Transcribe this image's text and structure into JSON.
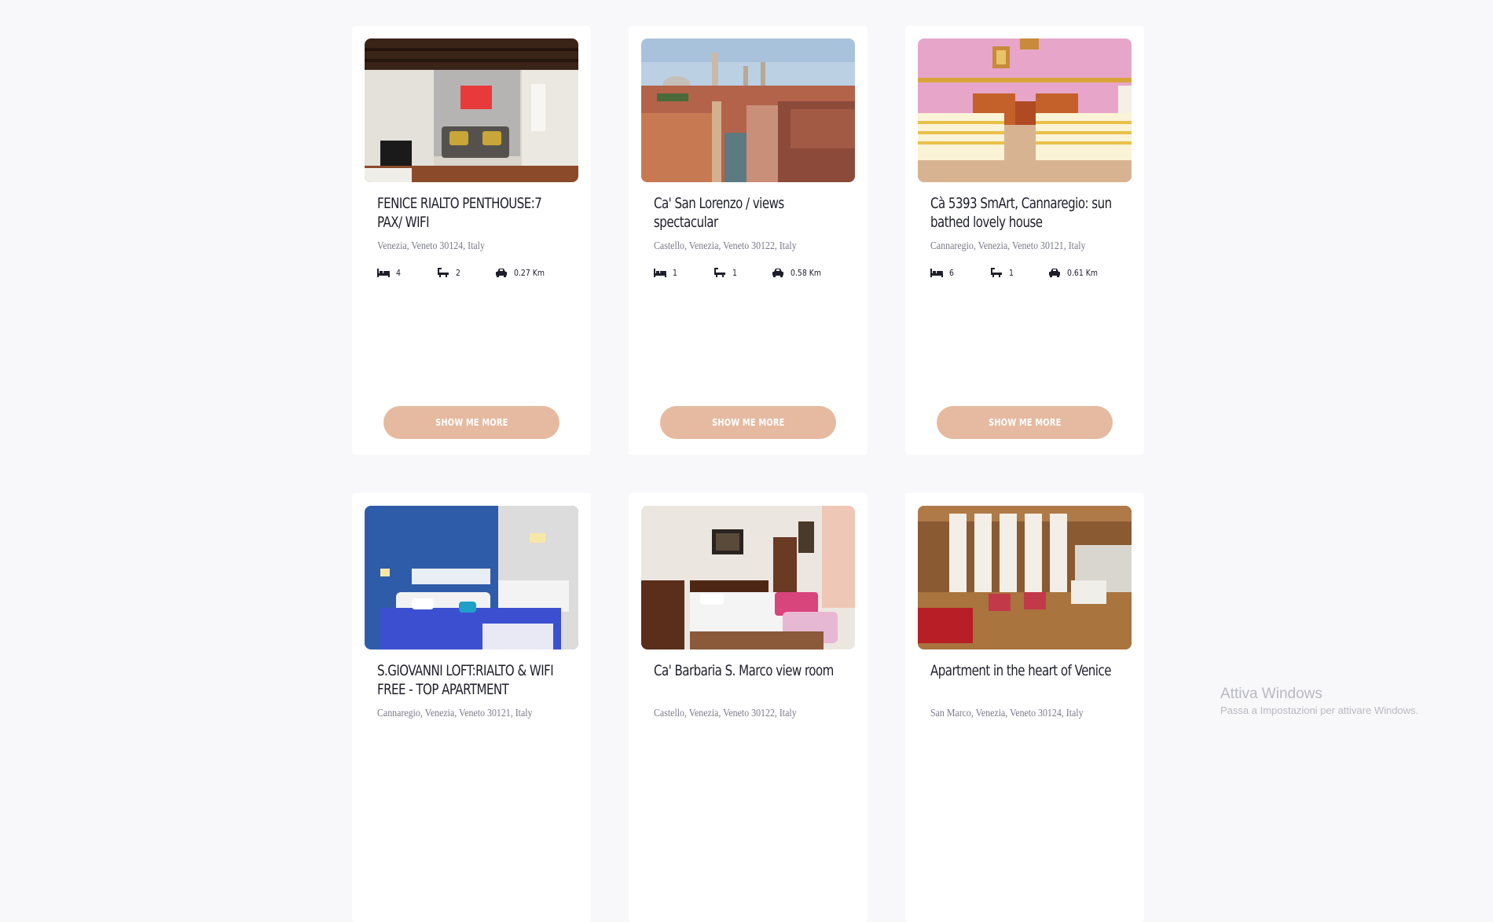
{
  "listings": [
    {
      "title": "FENICE RIALTO PENTHOUSE:7 PAX/ WIFI",
      "address": "Venezia, Veneto 30124, Italy",
      "beds": "4",
      "baths": "2",
      "distance": "0.27 Km",
      "button_label": "SHOW ME MORE",
      "photo": "living-room-sofa-photo"
    },
    {
      "title": "Ca' San Lorenzo / views spectacular",
      "address": "Castello, Venezia, Veneto 30122, Italy",
      "beds": "1",
      "baths": "1",
      "distance": "0.58 Km",
      "button_label": "SHOW ME MORE",
      "photo": "venice-rooftops-canal-photo"
    },
    {
      "title": "Cà 5393 SmArt, Cannaregio: sun bathed lovely house",
      "address": "Cannaregio, Venezia, Veneto 30121, Italy",
      "beds": "6",
      "baths": "1",
      "distance": "0.61 Km",
      "button_label": "SHOW ME MORE",
      "photo": "twin-beds-pink-room-photo"
    },
    {
      "title": "S.GIOVANNI LOFT:RIALTO & WIFI FREE - TOP APARTMENT",
      "address": "Cannaregio, Venezia, Veneto 30121, Italy",
      "photo": "blue-bedroom-photo"
    },
    {
      "title": "Ca' Barbaria S. Marco view room",
      "address": "Castello, Venezia, Veneto 30122, Italy",
      "photo": "antique-bedroom-photo"
    },
    {
      "title": "Apartment in the heart of Venice",
      "address": "San Marco, Venezia, Veneto 30124, Italy",
      "photo": "bright-living-room-photo"
    }
  ],
  "icons": {
    "beds": "bed-icon",
    "baths": "bathtub-icon",
    "distance": "car-icon"
  },
  "colors": {
    "button": "#e6baa0",
    "card": "#ffffff",
    "background": "#f8f8fb"
  },
  "watermark": {
    "line1": "Attiva Windows",
    "line2": "Passa a Impostazioni per attivare Windows."
  }
}
